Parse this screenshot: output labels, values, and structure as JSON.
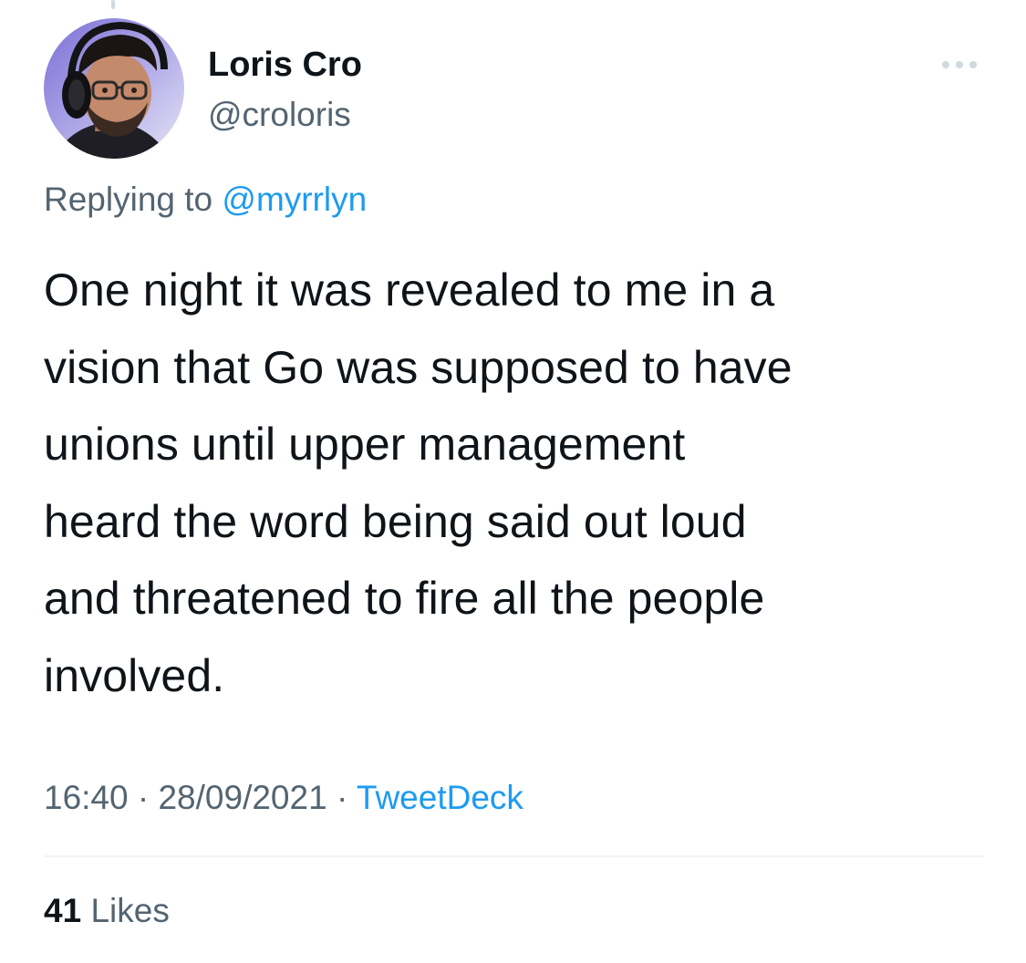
{
  "author": {
    "display_name": "Loris Cro",
    "handle": "@croloris",
    "avatar_icon": "avatar-photo"
  },
  "reply": {
    "prefix": "Replying to",
    "mention": "@myrrlyn"
  },
  "tweet": {
    "lines": [
      "One night it was revealed to me in a",
      "vision that Go was supposed to have",
      "unions until upper management",
      "heard the word being said out loud",
      "and threatened to fire all the people",
      "involved."
    ]
  },
  "meta": {
    "time": "16:40",
    "separator": "·",
    "date": "28/09/2021",
    "source": "TweetDeck"
  },
  "stats": {
    "likes_count": "41",
    "likes_label": "Likes"
  },
  "more_icon": "more-dots-icon",
  "colors": {
    "text": "#0f1419",
    "secondary": "#536471",
    "link": "#1d9bf0",
    "divider": "#eff3f4"
  }
}
